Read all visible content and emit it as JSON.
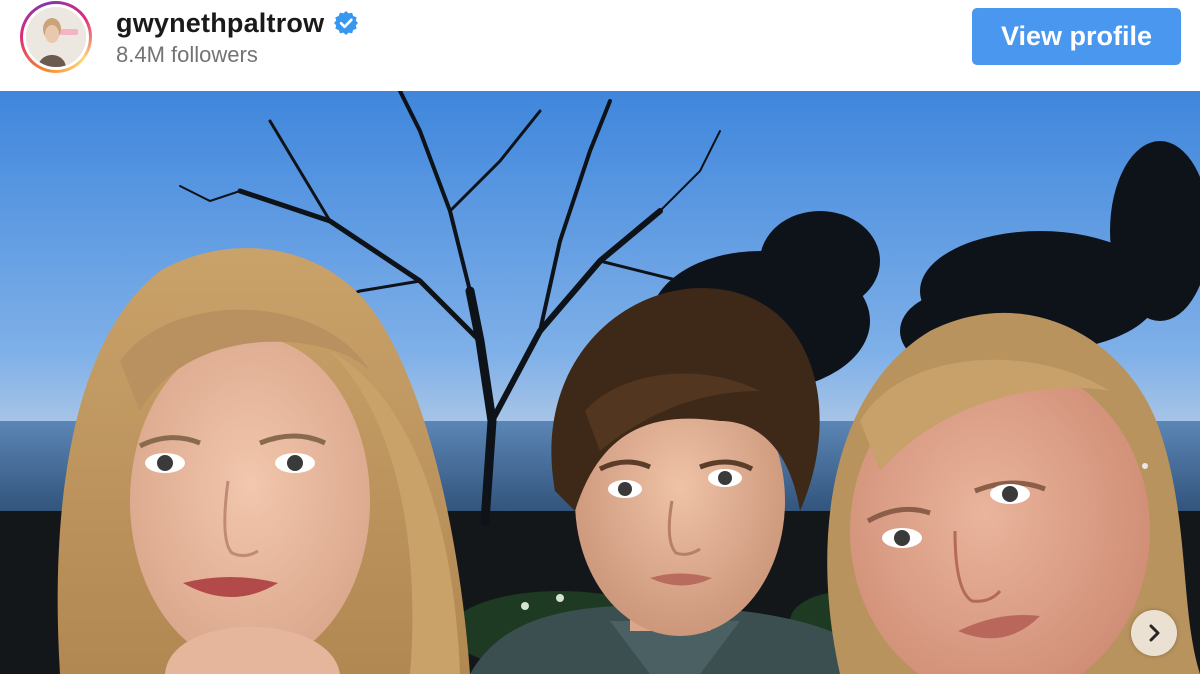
{
  "profile": {
    "username": "gwynethpaltrow",
    "followers": "8.4M followers",
    "verified": true,
    "view_profile_label": "View profile",
    "avatar_icon": "profile-avatar"
  },
  "post": {
    "media_type": "photo",
    "description_icon": "photo",
    "next_icon": "chevron-right-icon"
  },
  "colors": {
    "button_bg": "#4a97ef",
    "verified_badge": "#3897f0",
    "username_text": "#1a1a1a",
    "followers_text": "#737373"
  }
}
